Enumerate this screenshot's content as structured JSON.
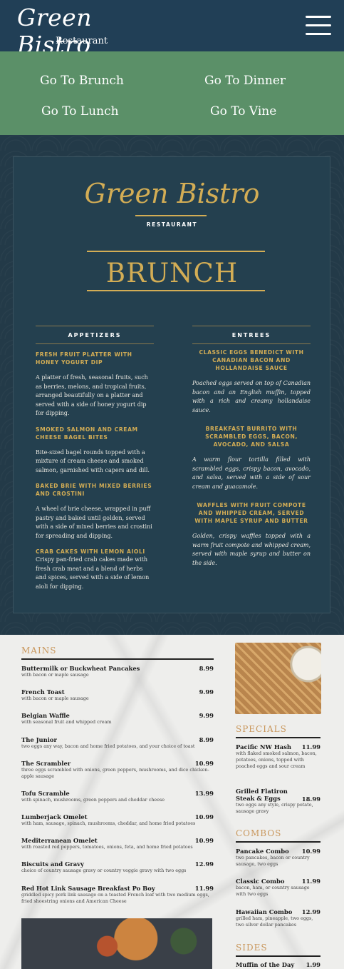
{
  "header": {
    "logo_script": "Green Bistro",
    "logo_sub": "Restaurant",
    "menu_icon": "hamburger-menu-icon"
  },
  "nav": {
    "brunch": "Go To Brunch",
    "dinner": "Go To Dinner",
    "lunch": "Go To Lunch",
    "vine": "Go To Vine"
  },
  "brunch_board": {
    "logo_script": "Green Bistro",
    "logo_sub": "RESTAURANT",
    "title": "BRUNCH",
    "appetizers": {
      "heading": "APPETIZERS",
      "items": [
        {
          "name": "FRESH FRUIT PLATTER WITH HONEY YOGURT DIP",
          "desc": "A platter of fresh, seasonal fruits, such as berries, melons, and tropical fruits, arranged beautifully on a platter and served with a side of honey yogurt dip for dipping."
        },
        {
          "name": "SMOKED SALMON AND CREAM CHEESE BAGEL BITES",
          "desc": "Bite-sized bagel rounds topped with a mixture of cream cheese and smoked salmon, garnished with capers and dill."
        },
        {
          "name": "BAKED BRIE WITH MIXED BERRIES AND CROSTINI",
          "desc": "A wheel of brie cheese, wrapped in puff pastry and baked until golden, served with a side of mixed berries and crostini for spreading and dipping."
        },
        {
          "name": "CRAB CAKES WITH LEMON AIOLI",
          "desc": "Crispy pan-fried crab cakes made with fresh crab meat and a blend of herbs and spices, served with a side of lemon aioli for dipping."
        }
      ]
    },
    "entrees": {
      "heading": "ENTREES",
      "items": [
        {
          "name": "CLASSIC EGGS BENEDICT WITH CANADIAN BACON AND HOLLANDAISE SAUCE",
          "desc": "Poached eggs served on top of Canadian bacon and an English muffin, topped with a rich and creamy hollandaise sauce."
        },
        {
          "name": "BREAKFAST BURRITO WITH SCRAMBLED EGGS, BACON, AVOCADO, AND SALSA",
          "desc": "A warm flour tortilla filled with scrambled eggs, crispy bacon, avocado, and salsa, served with a side of sour cream and guacamole."
        },
        {
          "name": "WAFFLES WITH FRUIT COMPOTE AND WHIPPED CREAM, SERVED WITH MAPLE SYRUP AND BUTTER",
          "desc": "Golden, crispy waffles topped with a warm fruit compote and whipped cream, served with maple syrup and butter on the side."
        }
      ]
    }
  },
  "mains": {
    "heading": "MAINS",
    "items": [
      {
        "name": "Buttermilk or Buckwheat Pancakes",
        "price": "8.99",
        "desc": "with bacon or maple sausage"
      },
      {
        "name": "French Toast",
        "price": "9.99",
        "desc": "with bacon or maple sausage"
      },
      {
        "name": "Belgian Waffle",
        "price": "9.99",
        "desc": "with seasonal fruit and whipped cream"
      },
      {
        "name": "The Junior",
        "price": "8.99",
        "desc": "two eggs any way, bacon and home fried potatoes, and your choice of toast"
      },
      {
        "name": "The Scrambler",
        "price": "10.99",
        "desc": "three eggs scrambled with onions, green peppers, mushrooms, and dice chicken-apple sausage"
      },
      {
        "name": "Tofu Scramble",
        "price": "13.99",
        "desc": "with spinach, mushrooms, green peppers and cheddar cheese"
      },
      {
        "name": "Lumberjack Omelet",
        "price": "10.99",
        "desc": "with ham, sausage, spinach, mushrooms, cheddar, and home fried potatoes"
      },
      {
        "name": "Mediterranean Omelet",
        "price": "10.99",
        "desc": "with roasted red peppers, tomatoes, onions, feta, and home fried potatoes"
      },
      {
        "name": "Biscuits and Gravy",
        "price": "12.99",
        "desc": "choice of country sausage gravy or country veggie gravy with two eggs"
      },
      {
        "name": "Red Hot Link Sausage Breakfast Po Boy",
        "price": "11.99",
        "desc": "griddled spicy pork link sausage on a toasted French loaf with two medium eggs, fried shoestring onions and American Cheese"
      }
    ]
  },
  "specials": {
    "heading": "SPECIALS",
    "items": [
      {
        "name": "Pacific NW Hash",
        "price": "11.99",
        "desc": "with flaked smoked salmon, bacon, potatoes, onions, topped with poached eggs and sour cream"
      },
      {
        "name": "Grilled Flatiron Steak & Eggs",
        "price": "18.99",
        "desc": "two eggs any style, crispy potato, sausage gravy"
      }
    ]
  },
  "combos": {
    "heading": "COMBOS",
    "items": [
      {
        "name": "Pancake Combo",
        "price": "10.99",
        "desc": "two pancakes, bacon or country sausage, two eggs"
      },
      {
        "name": "Classic Combo",
        "price": "11.99",
        "desc": "bacon, ham, or country sausage with two eggs"
      },
      {
        "name": "Hawaiian Combo",
        "price": "12.99",
        "desc": "grilled ham, pineapple, two eggs, two silver dollar pancakes"
      }
    ]
  },
  "sides": {
    "heading": "SIDES",
    "items": [
      {
        "name": "Muffin of the Day",
        "price": "1.99"
      }
    ]
  },
  "colors": {
    "header_bg": "#213f56",
    "nav_bg": "#5b9068",
    "board_bg": "#233a48",
    "gold": "#d3ad55",
    "section_head": "#c9975c"
  }
}
